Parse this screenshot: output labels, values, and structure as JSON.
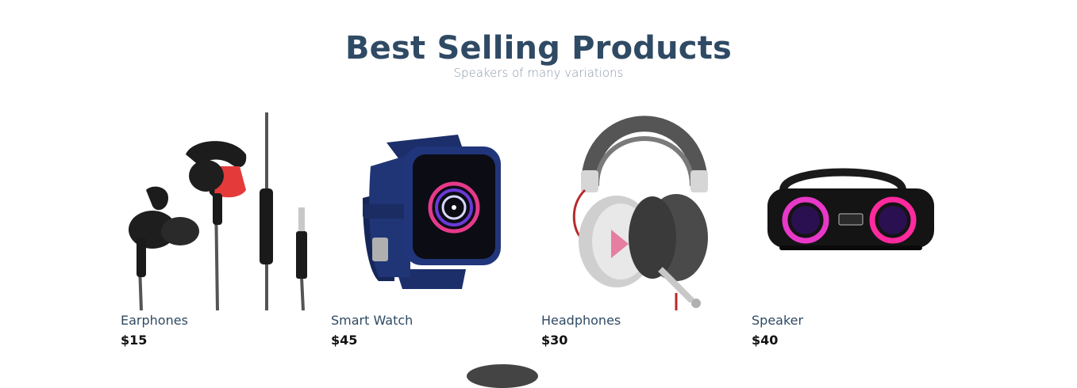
{
  "section": {
    "title": "Best Selling Products",
    "subtitle": "Speakers of many variations"
  },
  "products": [
    {
      "name": "Earphones",
      "price": "$15",
      "icon": "earphones-image"
    },
    {
      "name": "Smart Watch",
      "price": "$45",
      "icon": "smartwatch-image"
    },
    {
      "name": "Headphones",
      "price": "$30",
      "icon": "headphones-image"
    },
    {
      "name": "Speaker",
      "price": "$40",
      "icon": "speaker-image"
    }
  ],
  "colors": {
    "title": "#2f4a64",
    "subtitle": "#8b98a8",
    "accent_red": "#e53a3a",
    "watch_blue": "#1c2f6b"
  }
}
